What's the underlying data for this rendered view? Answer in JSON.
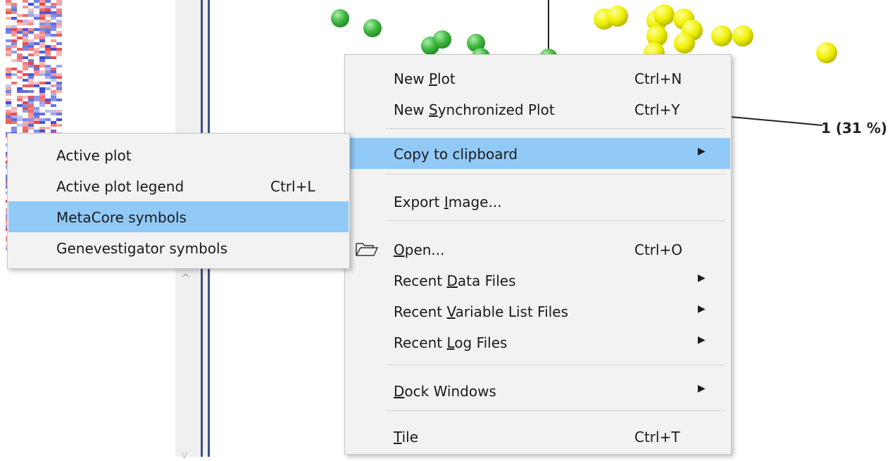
{
  "plot": {
    "axis_label": "1 (31 %)"
  },
  "splitter": {
    "scroll_up": "^",
    "scroll_down": "v"
  },
  "main_menu": {
    "items": [
      {
        "label": "New Plot",
        "mnemonic": "P",
        "shortcut": "Ctrl+N"
      },
      {
        "label": "New Synchronized Plot",
        "mnemonic": "S",
        "shortcut": "Ctrl+Y"
      },
      {
        "label": "Copy to clipboard",
        "has_submenu": true,
        "highlighted": true
      },
      {
        "label": "Export Image...",
        "mnemonic": "I"
      },
      {
        "label": "Open...",
        "mnemonic": "O",
        "shortcut": "Ctrl+O",
        "icon": "folder-open-icon"
      },
      {
        "label": "Recent Data Files",
        "mnemonic": "D",
        "has_submenu": true
      },
      {
        "label": "Recent Variable List Files",
        "mnemonic": "V",
        "has_submenu": true
      },
      {
        "label": "Recent Log Files",
        "mnemonic": "L",
        "has_submenu": true
      },
      {
        "label": "Dock Windows",
        "mnemonic": "D",
        "has_submenu": true
      },
      {
        "label": "Tile",
        "mnemonic": "T",
        "shortcut": "Ctrl+T"
      }
    ]
  },
  "sub_menu": {
    "items": [
      {
        "label": "Active plot"
      },
      {
        "label": "Active plot legend",
        "shortcut": "Ctrl+L"
      },
      {
        "label": "MetaCore symbols",
        "highlighted": true
      },
      {
        "label": "Genevestigator symbols"
      }
    ]
  },
  "colors": {
    "highlight": "#91c9f7",
    "menu_bg": "#f2f2f2",
    "green_ball": "#3cb43c",
    "yellow_ball": "#f0f000",
    "heatmap_red": "#e84040",
    "heatmap_blue": "#3a4ad8"
  }
}
